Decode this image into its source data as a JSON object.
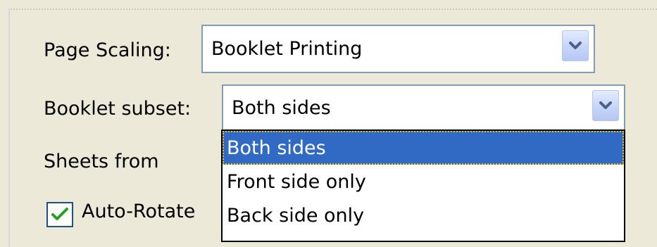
{
  "page_scaling": {
    "label": "Page Scaling:",
    "selected": "Booklet Printing"
  },
  "booklet_subset": {
    "label": "Booklet subset:",
    "selected": "Both sides",
    "options": [
      "Both sides",
      "Front side only",
      "Back side only"
    ],
    "highlighted_index": 0
  },
  "sheets": {
    "label": "Sheets from"
  },
  "auto_rotate": {
    "label": "Auto-Rotate",
    "checked": true
  },
  "colors": {
    "background": "#ece9d8",
    "select_border": "#7f9db9",
    "highlight": "#316ac5",
    "checkmark": "#21a121"
  },
  "icons": {
    "dropdown": "chevron-down-icon",
    "checkbox_mark": "checkmark-icon"
  }
}
